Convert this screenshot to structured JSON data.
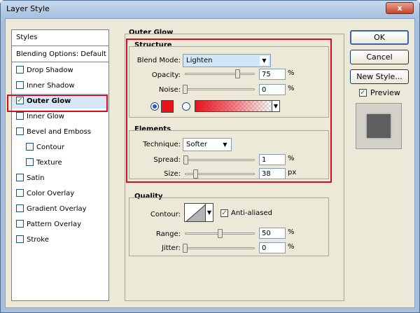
{
  "window": {
    "title": "Layer Style",
    "close_label": "x"
  },
  "styles_panel": {
    "header": "Styles",
    "blending_options": "Blending Options: Default",
    "items": [
      {
        "label": "Drop Shadow",
        "checked": false
      },
      {
        "label": "Inner Shadow",
        "checked": false
      },
      {
        "label": "Outer Glow",
        "checked": true
      },
      {
        "label": "Inner Glow",
        "checked": false
      },
      {
        "label": "Bevel and Emboss",
        "checked": false
      },
      {
        "label": "Contour",
        "checked": false
      },
      {
        "label": "Texture",
        "checked": false
      },
      {
        "label": "Satin",
        "checked": false
      },
      {
        "label": "Color Overlay",
        "checked": false
      },
      {
        "label": "Gradient Overlay",
        "checked": false
      },
      {
        "label": "Pattern Overlay",
        "checked": false
      },
      {
        "label": "Stroke",
        "checked": false
      }
    ]
  },
  "outer_glow": {
    "title": "Outer Glow",
    "structure": {
      "title": "Structure",
      "blend_mode_label": "Blend Mode:",
      "blend_mode_value": "Lighten",
      "opacity_label": "Opacity:",
      "opacity_value": "75",
      "opacity_unit": "%",
      "opacity_level": 0.75,
      "noise_label": "Noise:",
      "noise_value": "0",
      "noise_unit": "%",
      "noise_level": 0.0,
      "glow_color": "#e8141c"
    },
    "elements": {
      "title": "Elements",
      "technique_label": "Technique:",
      "technique_value": "Softer",
      "spread_label": "Spread:",
      "spread_value": "1",
      "spread_unit": "%",
      "spread_level": 0.01,
      "size_label": "Size:",
      "size_value": "38",
      "size_unit": "px",
      "size_level": 0.15
    },
    "quality": {
      "title": "Quality",
      "contour_label": "Contour:",
      "anti_aliased_label": "Anti-aliased",
      "anti_aliased_checked": true,
      "range_label": "Range:",
      "range_value": "50",
      "range_unit": "%",
      "range_level": 0.5,
      "jitter_label": "Jitter:",
      "jitter_value": "0",
      "jitter_unit": "%",
      "jitter_level": 0.0
    }
  },
  "buttons": {
    "ok": "OK",
    "cancel": "Cancel",
    "new_style": "New Style...",
    "preview_label": "Preview",
    "preview_checked": true
  },
  "colors": {
    "highlight_outline": "#d4101c",
    "accent": "#e8141c"
  }
}
